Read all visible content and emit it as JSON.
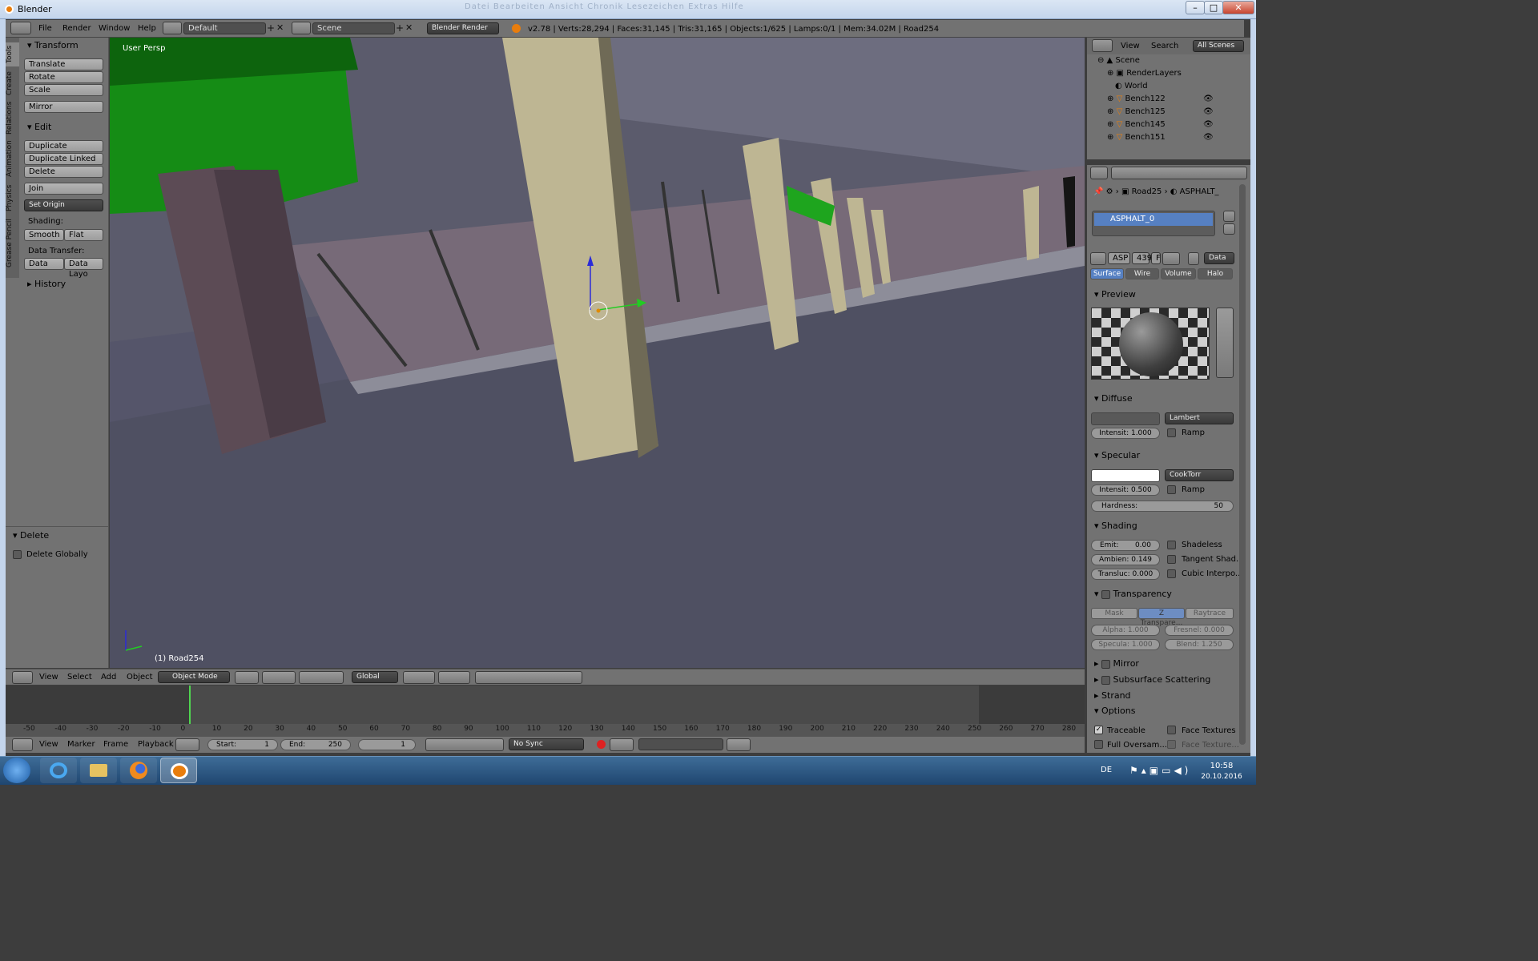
{
  "window": {
    "title": "Blender",
    "bg_ghost_text": "Datei  Bearbeiten  Ansicht  Chronik  Lesezeichen  Extras  Hilfe"
  },
  "menubar": {
    "items": [
      "File",
      "Render",
      "Window",
      "Help"
    ],
    "layout": "Default",
    "scene": "Scene",
    "engine": "Blender Render",
    "stats": "v2.78 | Verts:28,294 | Faces:31,145 | Tris:31,165 | Objects:1/625 | Lamps:0/1 | Mem:34.02M | Road254"
  },
  "tools": {
    "tabs": [
      "Tools",
      "Create",
      "Relations",
      "Animation",
      "Physics",
      "Grease Pencil"
    ],
    "transform_title": "Transform",
    "translate": "Translate",
    "rotate": "Rotate",
    "scale": "Scale",
    "mirror": "Mirror",
    "edit_title": "Edit",
    "duplicate": "Duplicate",
    "duplicate_linked": "Duplicate Linked",
    "delete": "Delete",
    "join": "Join",
    "set_origin": "Set Origin",
    "shading_label": "Shading:",
    "smooth": "Smooth",
    "flat": "Flat",
    "data_transfer_label": "Data Transfer:",
    "data": "Data",
    "data_layo": "Data Layo",
    "history_title": "History",
    "op_title": "Delete",
    "delete_globally": "Delete Globally"
  },
  "viewport": {
    "label": "User Persp",
    "object_label": "(1) Road254"
  },
  "viewport_header": {
    "menus": [
      "View",
      "Select",
      "Add",
      "Object"
    ],
    "mode": "Object Mode",
    "orientation": "Global"
  },
  "timeline": {
    "ticks": [
      "-50",
      "-40",
      "-30",
      "-20",
      "-10",
      "0",
      "10",
      "20",
      "30",
      "40",
      "50",
      "60",
      "70",
      "80",
      "90",
      "100",
      "110",
      "120",
      "130",
      "140",
      "150",
      "160",
      "170",
      "180",
      "190",
      "200",
      "210",
      "220",
      "230",
      "240",
      "250",
      "260",
      "270",
      "280"
    ],
    "current_frame_value": 0
  },
  "timeline_header": {
    "menus": [
      "View",
      "Marker",
      "Frame",
      "Playback"
    ],
    "start_label": "Start:",
    "start_value": "1",
    "end_label": "End:",
    "end_value": "250",
    "frame_value": "1",
    "sync": "No Sync"
  },
  "outliner": {
    "menus": [
      "View",
      "Search"
    ],
    "filter": "All Scenes",
    "rows": [
      "Scene",
      "RenderLayers",
      "World",
      "Bench122",
      "Bench125",
      "Bench145",
      "Bench151"
    ]
  },
  "properties": {
    "breadcrumb_object": "Road25",
    "breadcrumb_material": "ASPHALT_",
    "material_slot": "ASPHALT_0",
    "mat_name": "ASP",
    "mat_users": "439",
    "fake_user": "F",
    "data_dd": "Data",
    "tabs": [
      "Surface",
      "Wire",
      "Volume",
      "Halo"
    ],
    "preview_title": "Preview",
    "diffuse_title": "Diffuse",
    "diffuse_shader": "Lambert",
    "diffuse_intensity": "Intensit: 1.000",
    "ramp": "Ramp",
    "specular_title": "Specular",
    "specular_shader": "CookTorr",
    "specular_intensity": "Intensit: 0.500",
    "hardness": "Hardness:",
    "hardness_value": "50",
    "shading_title": "Shading",
    "emit": "Emit:",
    "emit_value": "0.00",
    "shadeless": "Shadeless",
    "ambient": "Ambien: 0.149",
    "tangent": "Tangent Shad...",
    "transluc": "Transluc: 0.000",
    "cubic": "Cubic Interpo...",
    "transparency_title": "Transparency",
    "mask": "Mask",
    "ztransp": "Z Transpare...",
    "raytrace": "Raytrace",
    "alpha": "Alpha:   1.000",
    "fresnel": "Fresnel:  0.000",
    "specula": "Specula:  1.000",
    "blend": "Blend:   1.250",
    "mirror_title": "Mirror",
    "sss_title": "Subsurface Scattering",
    "strand_title": "Strand",
    "options_title": "Options",
    "traceable": "Traceable",
    "face_textures": "Face Textures",
    "full_oversam": "Full Oversam...",
    "face_texture2": "Face Texture..."
  },
  "taskbar": {
    "lang": "DE",
    "time": "10:58",
    "date": "20.10.2016"
  },
  "colors": {
    "selected_blue": "#5680c2",
    "ui_panel": "#727272",
    "taskbar": "#24507e"
  }
}
